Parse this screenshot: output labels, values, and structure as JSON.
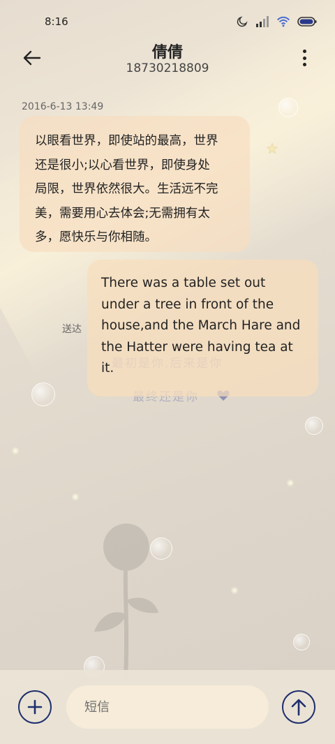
{
  "status_bar": {
    "time": "8:16",
    "icons": [
      "moon-icon",
      "signal-icon",
      "wifi-icon",
      "battery-icon"
    ]
  },
  "header": {
    "contact_name": "倩倩",
    "phone_number": "18730218809",
    "back_icon": "arrow-left-icon",
    "more_icon": "more-vertical-icon"
  },
  "conversation": {
    "timestamp": "2016-6-13 13:49",
    "incoming_message": {
      "lines": [
        "以眼看世界，即使站的最高，世界",
        "还是很小;以心看世界，即使身处",
        "局限，世界依然很大。生活远不完",
        "美，需要用心去体会;无需拥有太",
        "多，愿快乐与你相随。"
      ]
    },
    "outgoing_message": {
      "lines": [
        "There was a table set out",
        "under a tree in front of the",
        "house,and the March Hare and",
        "the Hatter were having tea at",
        "it."
      ],
      "status": "送达"
    }
  },
  "wallpaper": {
    "watermark_line1": "最初是你,后来是你",
    "watermark_line2": "最终还是你"
  },
  "composer": {
    "placeholder": "短信",
    "add_icon": "plus-icon",
    "send_icon": "arrow-up-icon"
  },
  "colors": {
    "accent": "#1f2f6e",
    "bubble": "#f6dec0"
  }
}
